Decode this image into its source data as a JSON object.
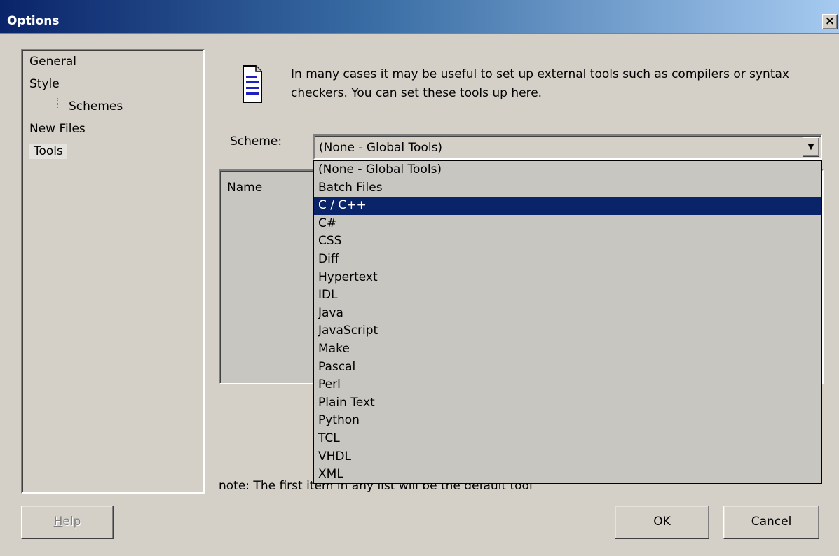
{
  "window": {
    "title": "Options",
    "close_label": "×"
  },
  "tree": {
    "items": [
      {
        "label": "General"
      },
      {
        "label": "Style"
      },
      {
        "label": "Schemes"
      },
      {
        "label": "New Files"
      },
      {
        "label": "Tools"
      }
    ],
    "selected": "Tools"
  },
  "intro": {
    "icon": "document-lines-icon",
    "text": "In many cases it may be useful to set up external tools such as compilers or syntax checkers. You can set these tools up here."
  },
  "scheme": {
    "label": "Scheme:",
    "value": "(None - Global Tools)",
    "arrow": "▼",
    "options": [
      "(None - Global Tools)",
      "Batch Files",
      "C / C++",
      "C#",
      "CSS",
      "Diff",
      "Hypertext",
      "IDL",
      "Java",
      "JavaScript",
      "Make",
      "Pascal",
      "Perl",
      "Plain Text",
      "Python",
      "TCL",
      "VHDL",
      "XML"
    ],
    "highlighted": "C / C++"
  },
  "tools_list": {
    "column_name": "Name"
  },
  "note": "note: The first item in any list will be the default tool",
  "buttons": {
    "help_prefix": "H",
    "help_rest": "elp",
    "ok": "OK",
    "cancel": "Cancel"
  },
  "colors": {
    "dialog_bg": "#d4d0c8",
    "titlebar_start": "#0a246a",
    "titlebar_end": "#a6caf0",
    "highlight": "#0a246a"
  }
}
